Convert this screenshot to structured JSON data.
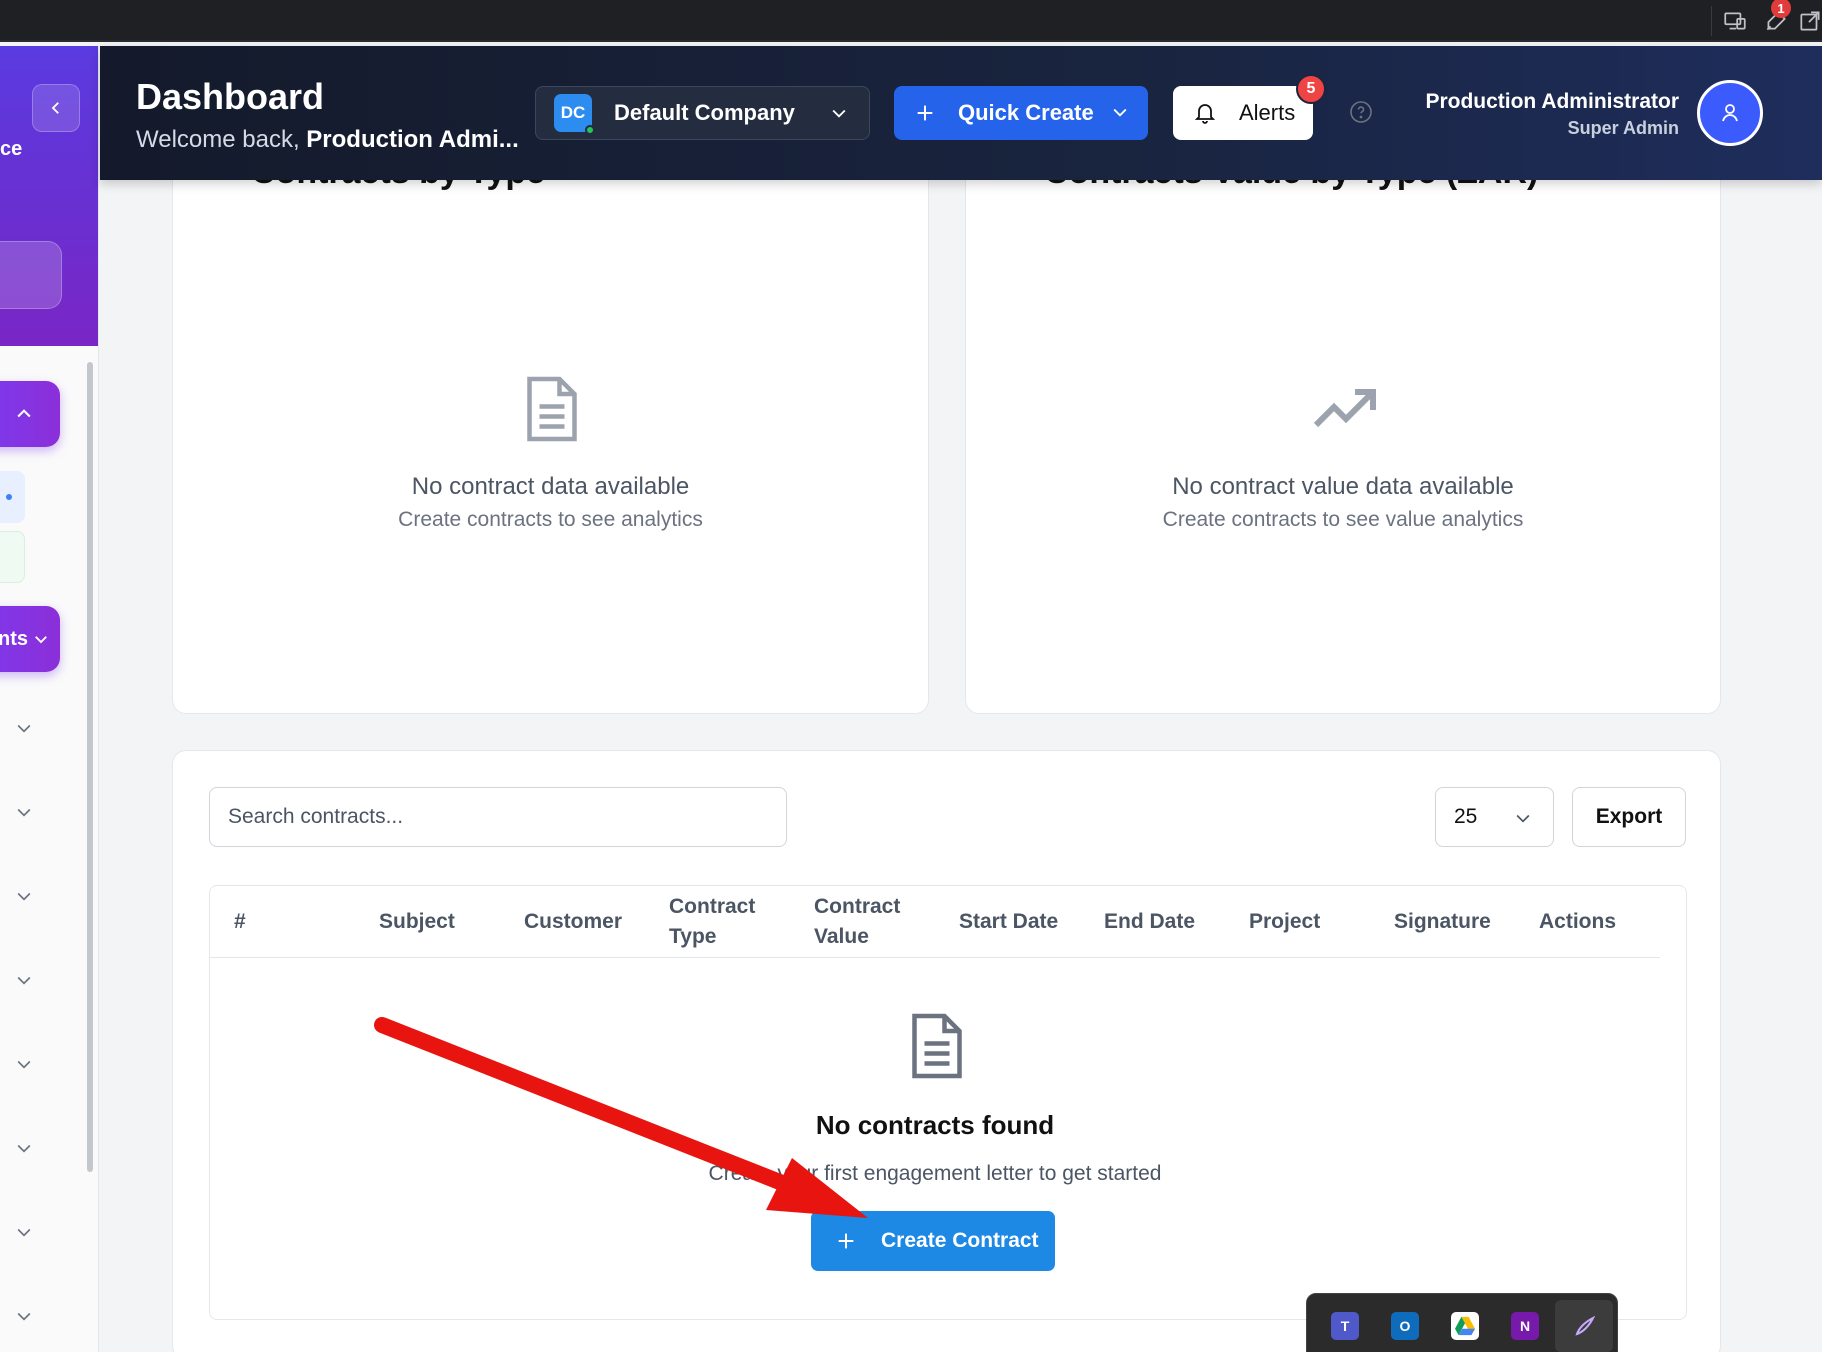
{
  "browser": {
    "notification_count": "1",
    "icons": [
      "cast-icon",
      "extension-icon",
      "open-external-icon"
    ]
  },
  "sidebar": {
    "brand_fragment": "ce",
    "active_item_label_fragment": "nts"
  },
  "header": {
    "title": "Dashboard",
    "welcome_prefix": "Welcome back, ",
    "welcome_name": "Production Admi...",
    "company": {
      "initials": "DC",
      "name": "Default Company"
    },
    "quick_create_label": "Quick Create",
    "alerts_label": "Alerts",
    "alerts_count": "5",
    "user_name": "Production Administrator",
    "user_role": "Super Admin"
  },
  "cards": {
    "left": {
      "heading": "Contracts by Type",
      "empty_title": "No contract data available",
      "empty_sub": "Create contracts to see analytics"
    },
    "right": {
      "heading": "Contracts Value by Type (ZAR)",
      "empty_title": "No contract value data available",
      "empty_sub": "Create contracts to see value analytics"
    }
  },
  "table": {
    "search_placeholder": "Search contracts...",
    "per_page": "25",
    "export_label": "Export",
    "columns": [
      "#",
      "Subject",
      "Customer",
      "Contract Type",
      "Contract Value",
      "Start Date",
      "End Date",
      "Project",
      "Signature",
      "Actions"
    ],
    "empty_title": "No contracts found",
    "empty_sub": "Create your first engagement letter to get started",
    "create_label": "Create Contract"
  },
  "colors": {
    "primary": "#2563eb",
    "create_button": "#1e88e5",
    "sidebar_purple": "#7c3aed",
    "alert_badge": "#ef4444",
    "annotation_arrow": "#e8140f"
  },
  "taskbar": {
    "icons": [
      "teams-icon",
      "outlook-icon",
      "google-drive-icon",
      "onenote-icon",
      "pen-icon"
    ]
  }
}
